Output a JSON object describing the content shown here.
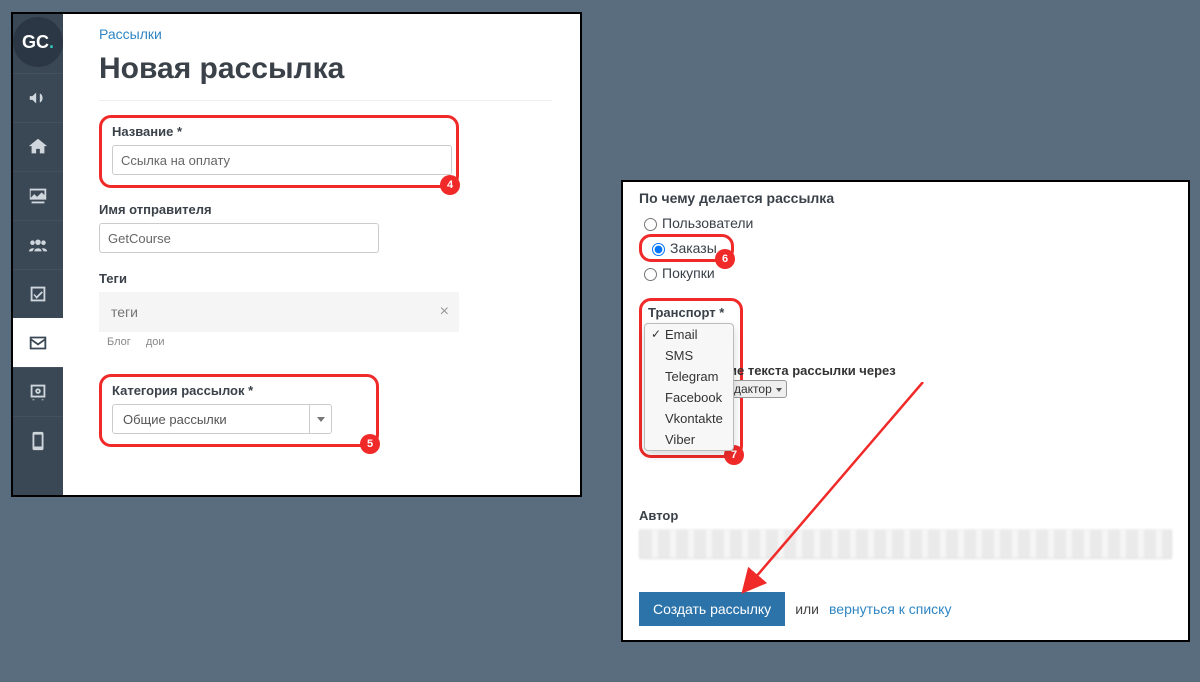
{
  "logo": "GC.",
  "breadcrumb": "Рассылки",
  "page_title": "Новая рассылка",
  "left": {
    "name_label": "Название *",
    "name_value": "Ссылка на оплату",
    "sender_label": "Имя отправителя",
    "sender_value": "GetCourse",
    "tags_label": "Теги",
    "tags_placeholder": "теги",
    "tag1": "Блог",
    "tag2": "дои",
    "category_label": "Категория рассылок *",
    "category_value": "Общие рассылки"
  },
  "badge4": "4",
  "badge5": "5",
  "badge6": "6",
  "badge7": "7",
  "right": {
    "basis_label": "По чему делается рассылка",
    "basis_opt1": "Пользователи",
    "basis_opt2": "Заказы",
    "basis_opt3": "Покупки",
    "transport_label": "Транспорт *",
    "tr_email": "Email",
    "tr_sms": "SMS",
    "tr_tg": "Telegram",
    "tr_fb": "Facebook",
    "tr_vk": "Vkontakte",
    "tr_viber": "Viber",
    "edit_hint": "ие текста рассылки через",
    "edit_select": "дактор",
    "author_label": "Автор",
    "submit": "Создать рассылку",
    "or": "или",
    "back": "вернуться к списку"
  }
}
